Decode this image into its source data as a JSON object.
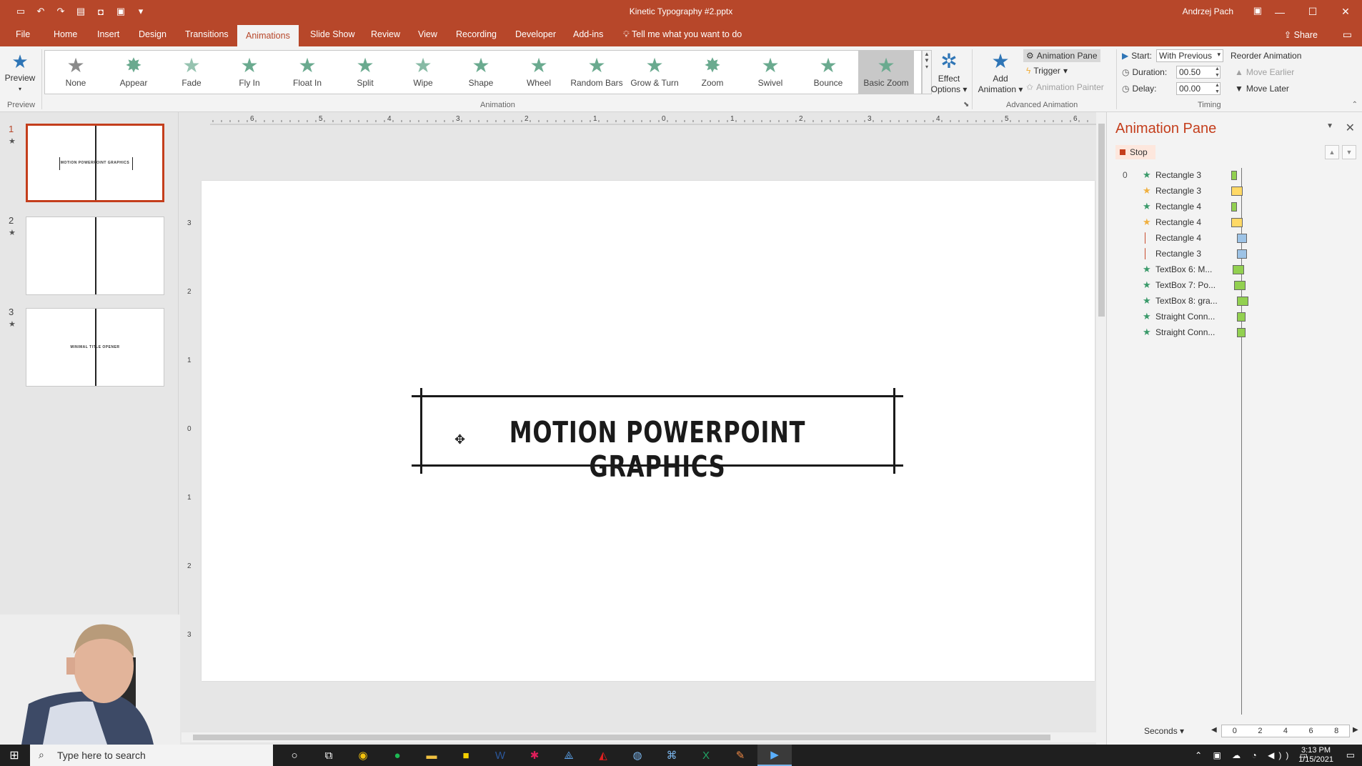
{
  "window": {
    "doc_title": "Kinetic Typography #2.pptx",
    "user": "Andrzej Pach"
  },
  "tabs": [
    "File",
    "Home",
    "Insert",
    "Design",
    "Transitions",
    "Animations",
    "Slide Show",
    "Review",
    "View",
    "Recording",
    "Developer",
    "Add-ins"
  ],
  "active_tab": "Animations",
  "tell_me": "Tell me what you want to do",
  "share": "Share",
  "ribbon": {
    "preview": "Preview",
    "preview_group": "Preview",
    "animation_group": "Animation",
    "effects": [
      "None",
      "Appear",
      "Fade",
      "Fly In",
      "Float In",
      "Split",
      "Wipe",
      "Shape",
      "Wheel",
      "Random Bars",
      "Grow & Turn",
      "Zoom",
      "Swivel",
      "Bounce",
      "Basic Zoom"
    ],
    "selected_effect": "Basic Zoom",
    "effect_options_1": "Effect",
    "effect_options_2": "Options",
    "add_animation_1": "Add",
    "add_animation_2": "Animation",
    "animation_pane": "Animation Pane",
    "trigger": "Trigger",
    "animation_painter": "Animation Painter",
    "advanced_group": "Advanced Animation",
    "start_label": "Start:",
    "start_value": "With Previous",
    "duration_label": "Duration:",
    "duration_value": "00.50",
    "delay_label": "Delay:",
    "delay_value": "00.00",
    "reorder": "Reorder Animation",
    "move_earlier": "Move Earlier",
    "move_later": "Move Later",
    "timing_group": "Timing"
  },
  "slides": [
    {
      "num": "1",
      "text": "MOTION POWERPOINT GRAPHICS"
    },
    {
      "num": "2",
      "text": ""
    },
    {
      "num": "3",
      "text": "MINIMAL TITLE OPENER"
    }
  ],
  "slide": {
    "title_text": "MOTION POWERPOINT GRAPHICS"
  },
  "hruler_ticks": [
    "6",
    "5",
    "4",
    "3",
    "2",
    "1",
    "0",
    "1",
    "2",
    "3",
    "4",
    "5",
    "6"
  ],
  "vruler_ticks": [
    "3",
    "2",
    "1",
    "0",
    "1",
    "2",
    "3"
  ],
  "anim_pane": {
    "title": "Animation Pane",
    "stop": "Stop",
    "items": [
      {
        "idx": "0",
        "icon": "★",
        "icon_color": "#3a9a6a",
        "name": "Rectangle 3",
        "bar_color": "#92d050"
      },
      {
        "idx": "",
        "icon": "★",
        "icon_color": "#f0b040",
        "name": "Rectangle 3",
        "bar_color": "#ffd966"
      },
      {
        "idx": "",
        "icon": "★",
        "icon_color": "#3a9a6a",
        "name": "Rectangle 4",
        "bar_color": "#92d050"
      },
      {
        "idx": "",
        "icon": "★",
        "icon_color": "#f0b040",
        "name": "Rectangle 4",
        "bar_color": "#ffd966"
      },
      {
        "idx": "",
        "icon": "│",
        "icon_color": "#c43e1c",
        "name": "Rectangle 4",
        "bar_color": "#9dc3e6"
      },
      {
        "idx": "",
        "icon": "│",
        "icon_color": "#c43e1c",
        "name": "Rectangle 3",
        "bar_color": "#9dc3e6"
      },
      {
        "idx": "",
        "icon": "★",
        "icon_color": "#3a9a6a",
        "name": "TextBox 6: M...",
        "bar_color": "#92d050"
      },
      {
        "idx": "",
        "icon": "★",
        "icon_color": "#3a9a6a",
        "name": "TextBox 7: Po...",
        "bar_color": "#92d050"
      },
      {
        "idx": "",
        "icon": "★",
        "icon_color": "#3a9a6a",
        "name": "TextBox 8: gra...",
        "bar_color": "#92d050"
      },
      {
        "idx": "",
        "icon": "★",
        "icon_color": "#3a9a6a",
        "name": "Straight Conn...",
        "bar_color": "#92d050"
      },
      {
        "idx": "",
        "icon": "★",
        "icon_color": "#3a9a6a",
        "name": "Straight Conn...",
        "bar_color": "#92d050"
      }
    ],
    "seconds": "Seconds",
    "scale": [
      "0",
      "2",
      "4",
      "6",
      "8"
    ]
  },
  "taskbar": {
    "search_placeholder": "Type here to search",
    "time": "3:13 PM",
    "date": "1/15/2021"
  }
}
